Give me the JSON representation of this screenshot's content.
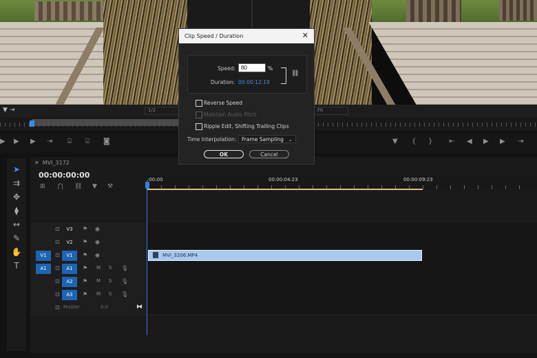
{
  "dialog": {
    "title": "Clip Speed / Duration",
    "speed_label": "Speed:",
    "speed_value": "80",
    "speed_unit": "%",
    "duration_label": "Duration:",
    "duration_value": "00:00:12:19",
    "reverse_speed": "Reverse Speed",
    "maintain_audio_pitch": "Maintain Audio Pitch",
    "ripple_edit": "Ripple Edit, Shifting Trailing Clips",
    "time_interp_label": "Time Interpolation:",
    "time_interp_value": "Frame Sampling",
    "ok_label": "OK",
    "cancel_label": "Cancel",
    "checkboxes": {
      "reverse_speed": false,
      "maintain_audio_pitch": false,
      "ripple_edit": false
    }
  },
  "monitor": {
    "zoom_value": "1/2",
    "fit_value": "Fit"
  },
  "timeline": {
    "sequence_name": "MVI_3172",
    "timecode": "00:00:00:00",
    "ruler": {
      "start": ":00:00",
      "mid": "00:00:04:23",
      "end": "00:00:09:23"
    },
    "tracks": {
      "v3": "V3",
      "v2": "V2",
      "v1": "V1",
      "v1_source": "V1",
      "a1": "A1",
      "a1_source": "A1",
      "a2": "A2",
      "a3": "A3",
      "master": "Master",
      "master_value": "0.0",
      "m": "M",
      "s": "S"
    },
    "clip_name": "MVI_3206.MP4"
  },
  "colors": {
    "accent": "#2f7fe6",
    "track_patch": "#1d64b4",
    "clip": "#a8c8ee"
  }
}
